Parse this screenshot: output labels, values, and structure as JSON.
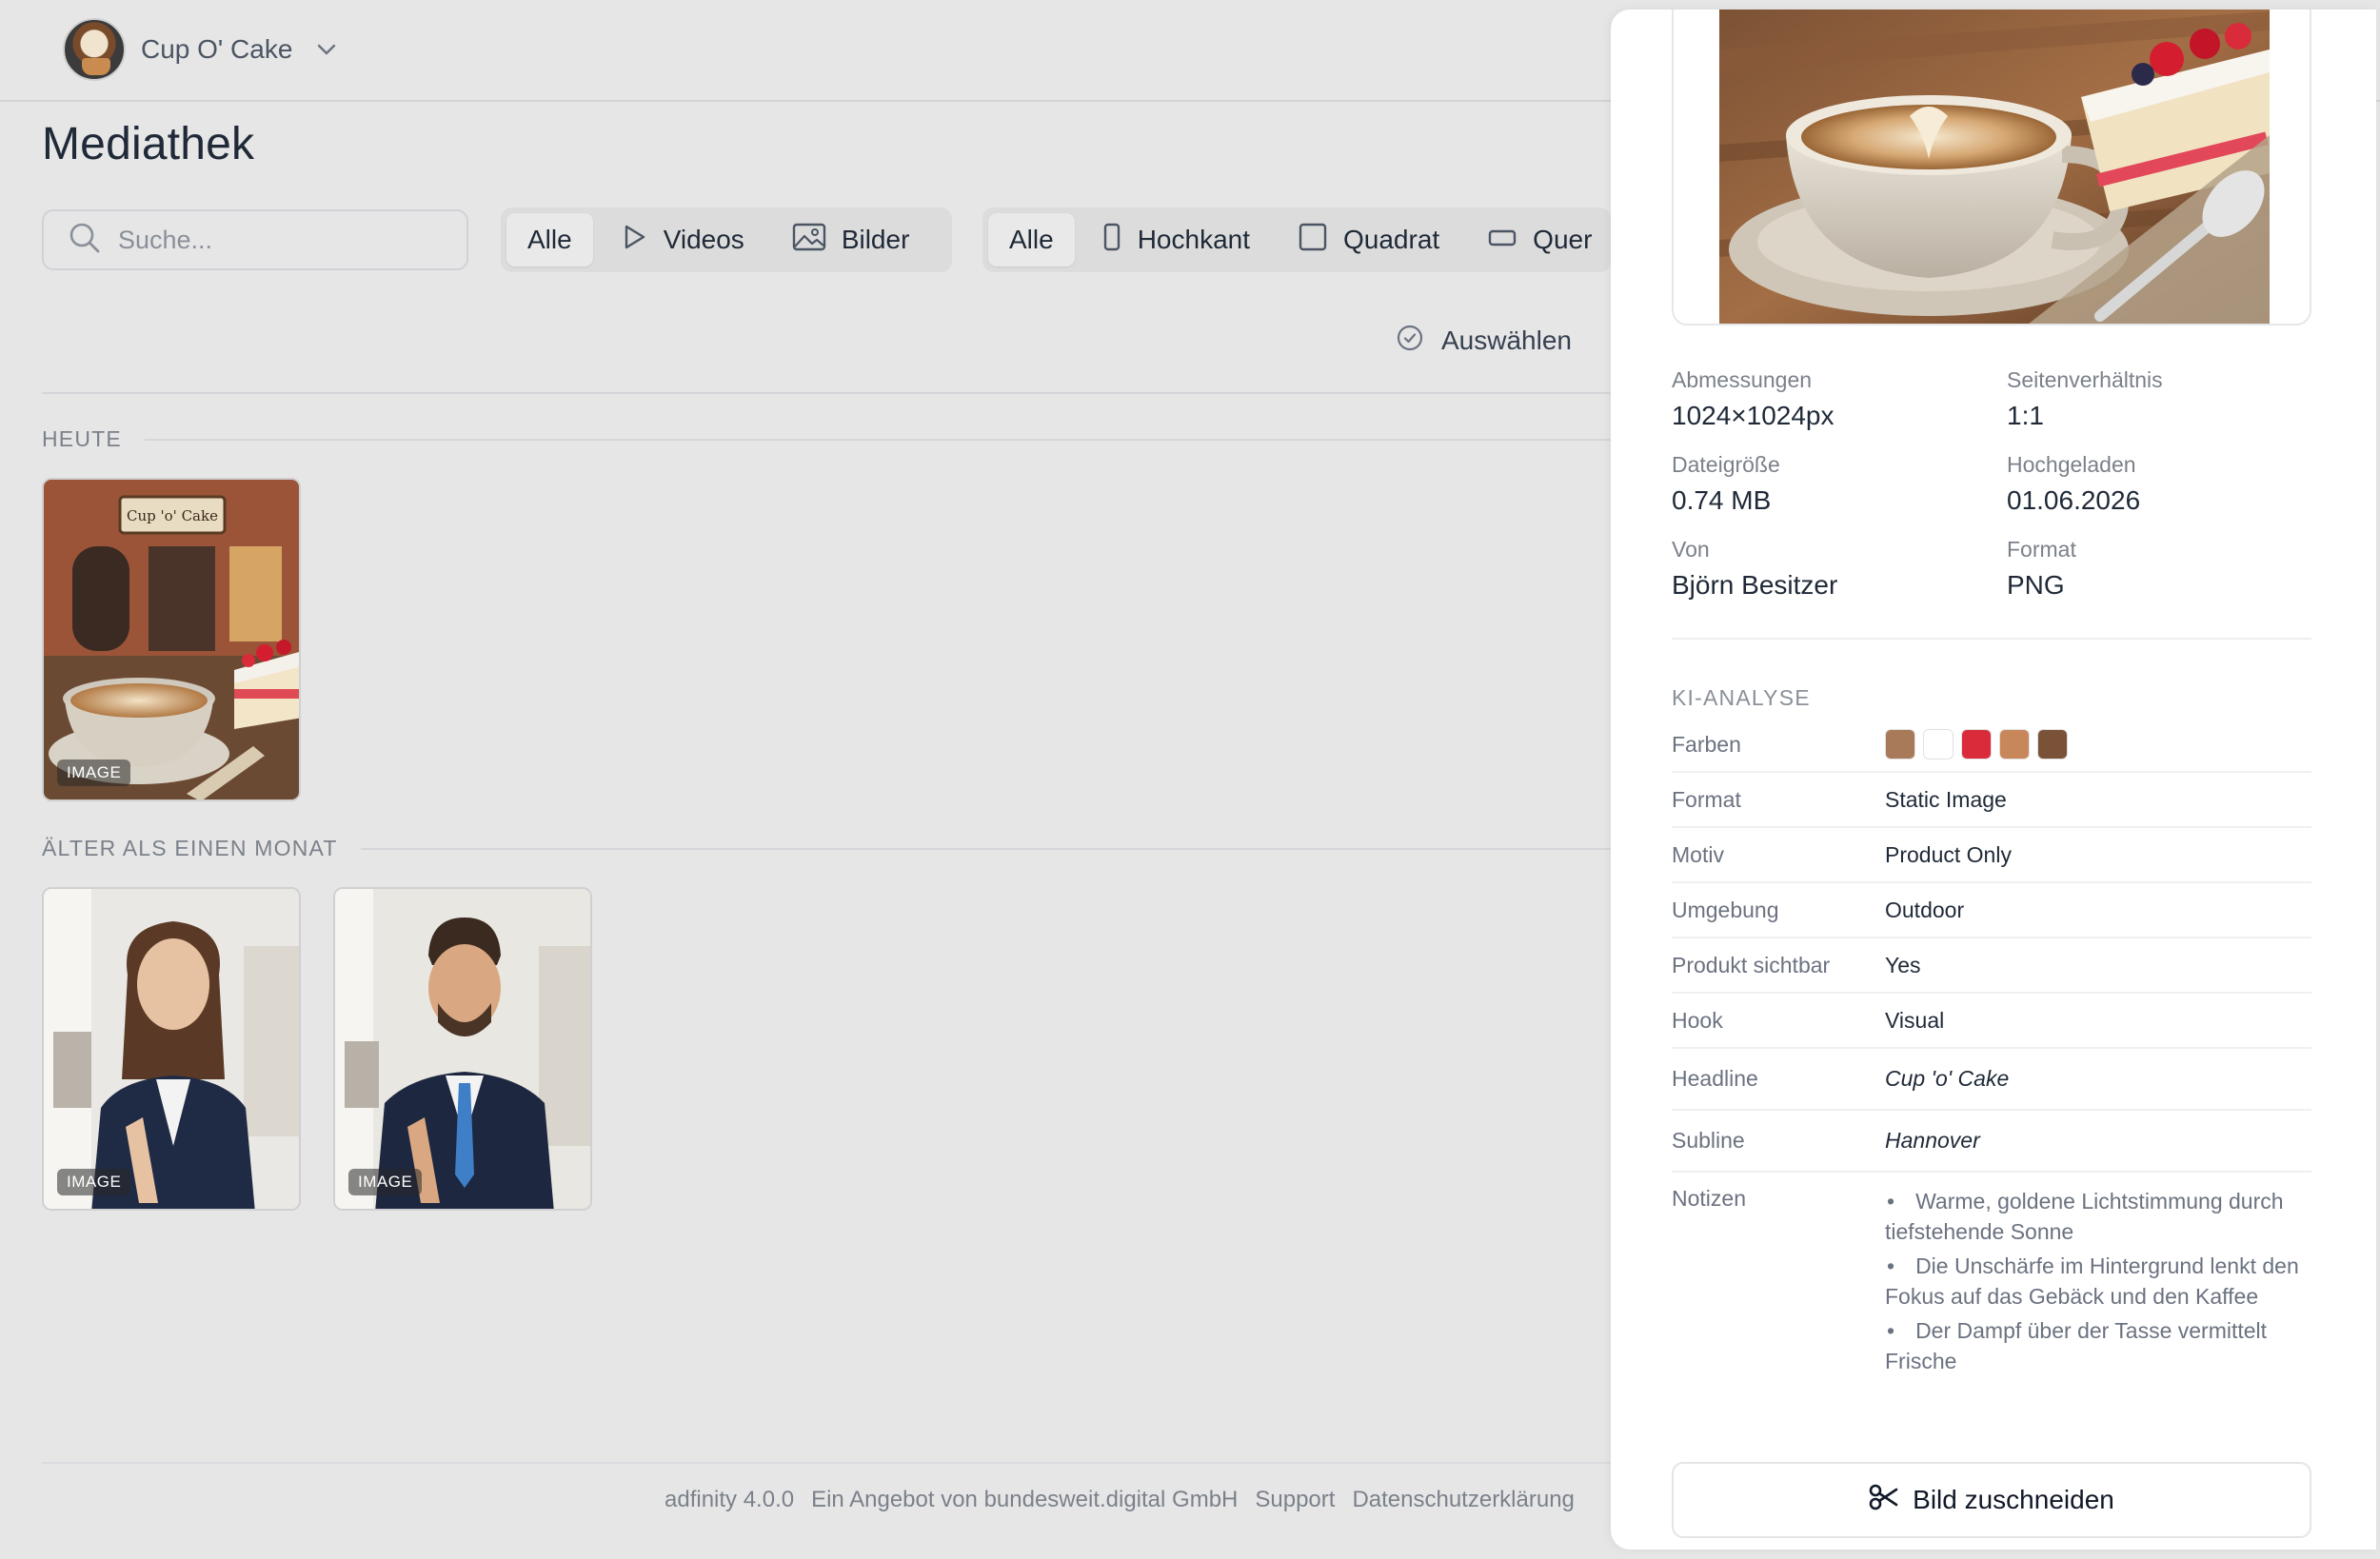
{
  "workspace": {
    "name": "Cup O' Cake"
  },
  "page": {
    "title": "Mediathek"
  },
  "search": {
    "placeholder": "Suche..."
  },
  "media_filter": {
    "all": "Alle",
    "videos": "Videos",
    "images": "Bilder",
    "selected": "Alle"
  },
  "orientation_filter": {
    "all": "Alle",
    "portrait": "Hochkant",
    "square": "Quadrat",
    "landscape": "Quer",
    "selected": "Alle"
  },
  "select_button": "Auswählen",
  "sections": [
    {
      "label": "HEUTE",
      "items": [
        {
          "badge": "IMAGE"
        }
      ]
    },
    {
      "label": "ÄLTER ALS EINEN MONAT",
      "items": [
        {
          "badge": "IMAGE"
        },
        {
          "badge": "IMAGE"
        }
      ]
    }
  ],
  "footer": {
    "version": "adfinity 4.0.0",
    "offer": "Ein Angebot von bundesweit.digital GmbH",
    "support": "Support",
    "privacy": "Datenschutzerklärung"
  },
  "details": {
    "dimensions_label": "Abmessungen",
    "dimensions": "1024×1024px",
    "aspect_label": "Seitenverhältnis",
    "aspect": "1:1",
    "filesize_label": "Dateigröße",
    "filesize": "0.74 MB",
    "uploaded_label": "Hochgeladen",
    "uploaded": "01.06.2026",
    "by_label": "Von",
    "by": "Björn Besitzer",
    "format_label": "Format",
    "format": "PNG"
  },
  "ki": {
    "title": "KI-ANALYSE",
    "colors_label": "Farben",
    "colors": [
      "#a87a5a",
      "#ffffff",
      "#d92b3a",
      "#c8875a",
      "#7a5238"
    ],
    "rows": [
      {
        "key": "Format",
        "value": "Static Image"
      },
      {
        "key": "Motiv",
        "value": "Product Only"
      },
      {
        "key": "Umgebung",
        "value": "Outdoor"
      },
      {
        "key": "Produkt sichtbar",
        "value": "Yes"
      },
      {
        "key": "Hook",
        "value": "Visual"
      },
      {
        "key": "Headline",
        "value": "Cup 'o' Cake"
      },
      {
        "key": "Subline",
        "value": "Hannover"
      }
    ],
    "notes_label": "Notizen",
    "notes": [
      "Warme, goldene Lichtstimmung durch tiefstehende Sonne",
      "Die Unschärfe im Hintergrund lenkt den Fokus auf das Gebäck und den Kaffee",
      "Der Dampf über der Tasse vermittelt Frische"
    ]
  },
  "crop_button": "Bild zuschneiden"
}
